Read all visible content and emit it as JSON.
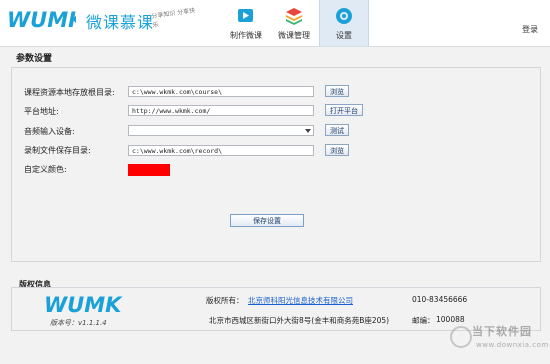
{
  "header": {
    "brand_mark": "WUMK",
    "brand_name": "微课慕课",
    "slogan": "分享知识 分享快乐",
    "nav": [
      {
        "label": "制作微课",
        "icon": "video-camera-icon",
        "active": false
      },
      {
        "label": "微课管理",
        "icon": "layers-icon",
        "active": false
      },
      {
        "label": "设置",
        "icon": "gear-icon",
        "active": true
      }
    ],
    "login": "登录"
  },
  "settings": {
    "tab": "参数设置",
    "rows": [
      {
        "label": "课程资源本地存放根目录:",
        "value": "c:\\www.wkmk.com\\course\\",
        "button": "浏览"
      },
      {
        "label": "平台地址:",
        "value": "http://www.wkmk.com/",
        "button": "打开平台"
      },
      {
        "label": "音频输入设备:",
        "value": "",
        "button": "测试"
      },
      {
        "label": "录制文件保存目录:",
        "value": "c:\\www.wkmk.com\\record\\",
        "button": "浏览"
      },
      {
        "label": "自定义颜色:",
        "color": "#ff0000"
      }
    ],
    "save": "保存设置"
  },
  "copyright": {
    "title": "版权信息",
    "logo": "WUMK",
    "version": "版本号：v1.1.1.4",
    "owner_label": "版权所有：",
    "owner": "北京师科阳光信息技术有限公司",
    "phone": "010-83456666",
    "address": "北京市西城区新街口外大街8号(金丰和商务苑B座205)",
    "postcode_label": "邮编：",
    "postcode": "100088"
  },
  "watermark": {
    "title": "当下软件园",
    "url": "www.downxia.com"
  },
  "colors": {
    "accent": "#1aa1d8",
    "tab_underline": "#3a8ee6",
    "link": "#1a5fd0"
  }
}
